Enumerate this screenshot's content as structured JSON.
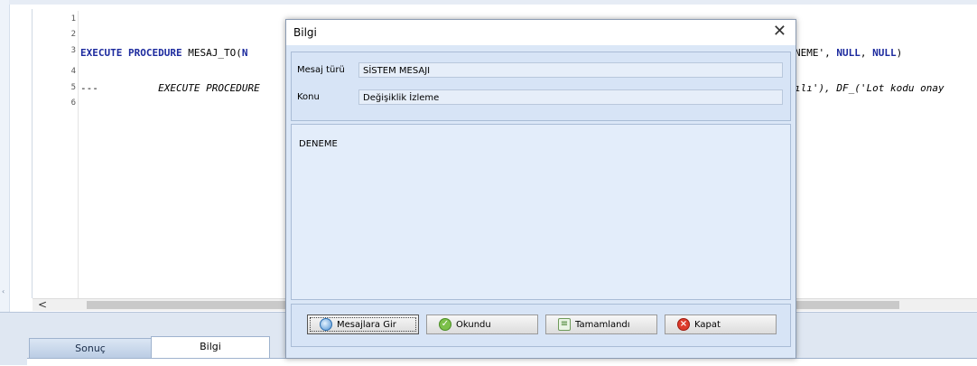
{
  "editor": {
    "line_numbers": [
      "1",
      "2",
      "3",
      "4",
      "5",
      "6"
    ],
    "line3": {
      "kw1": "EXECUTE PROCEDURE",
      "plain1": " MESAJ_TO(",
      "kw_n": "N",
      "tail": "NEME', ",
      "null1": "NULL",
      "sep": ", ",
      "null2": "NULL",
      "end": ")"
    },
    "line5": {
      "dashes": "---",
      "text": "EXECUTE PROCEDURE",
      "tail": "ılı'), DF_('Lot kodu onay"
    }
  },
  "tabs": [
    {
      "label": "Sonuç"
    },
    {
      "label": "Bilgi"
    }
  ],
  "dialog": {
    "title": "Bilgi",
    "close_glyph": "✕",
    "fields": [
      {
        "label": "Mesaj türü",
        "value": "SİSTEM MESAJI"
      },
      {
        "label": "Konu",
        "value": "Değişiklik İzleme"
      }
    ],
    "message": "DENEME",
    "buttons": [
      {
        "label": "Mesajlara Gir",
        "icon": "messages-icon"
      },
      {
        "label": "Okundu",
        "icon": "check-icon"
      },
      {
        "label": "Tamamlandı",
        "icon": "complete-icon"
      },
      {
        "label": "Kapat",
        "icon": "close-red-icon"
      }
    ]
  },
  "scrollbar": {
    "left_arrow": "<"
  },
  "left_bar_glyph": "‹"
}
